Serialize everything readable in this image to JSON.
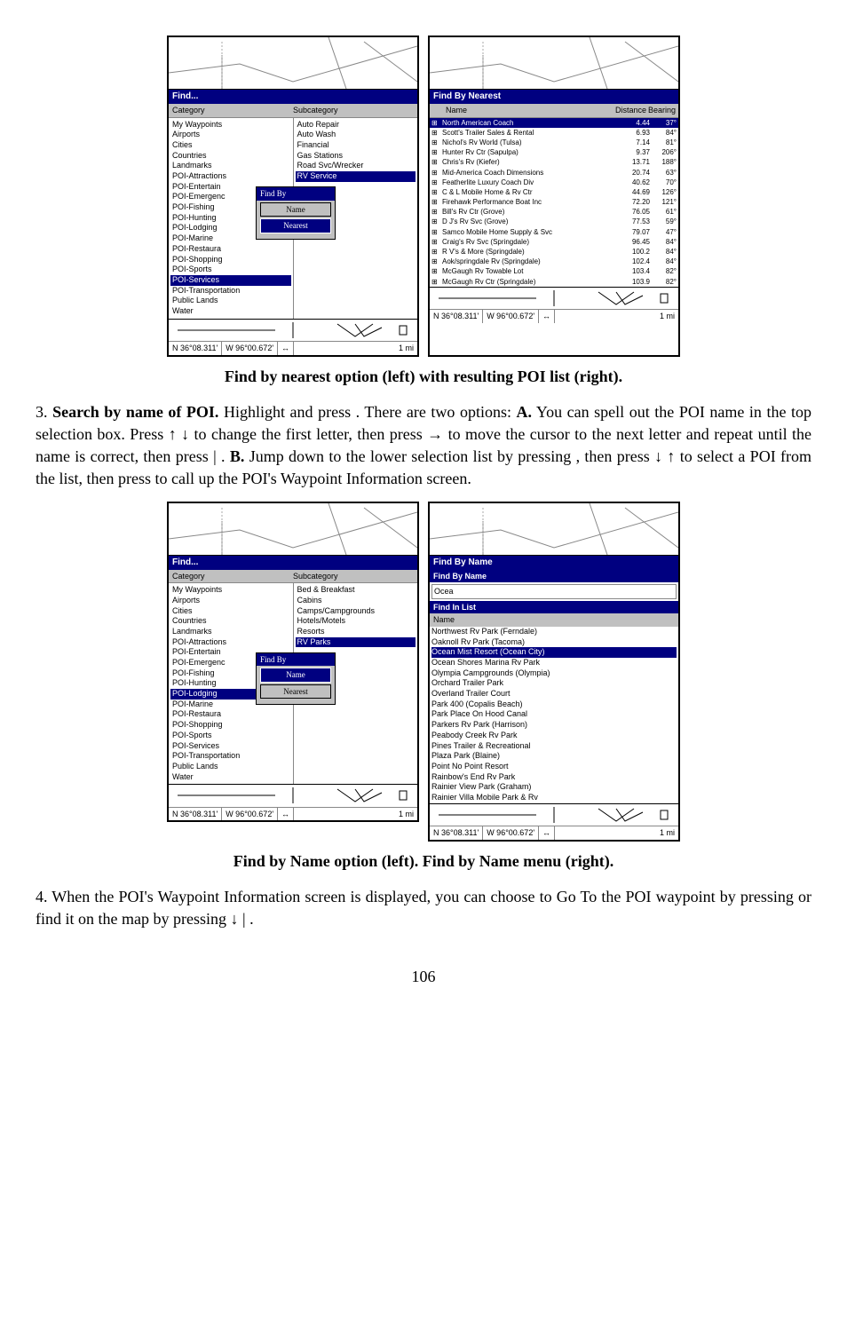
{
  "screen1_left": {
    "title": "Find...",
    "header_cat": "Category",
    "header_sub": "Subcategory",
    "categories": [
      "My Waypoints",
      "Airports",
      "Cities",
      "Countries",
      "Landmarks",
      "POI-Attractions",
      "POI-Entertain",
      "POI-Emergenc",
      "POI-Fishing",
      "POI-Hunting",
      "POI-Lodging",
      "POI-Marine",
      "POI-Restaura",
      "POI-Shopping",
      "POI-Sports",
      "POI-Services",
      "POI-Transportation",
      "Public Lands",
      "Water"
    ],
    "cat_sel_index": 15,
    "subcategories": [
      "Auto Repair",
      "Auto Wash",
      "Financial",
      "Gas Stations",
      "Road Svc/Wrecker",
      "RV Service"
    ],
    "sub_sel_index": 5,
    "popup_title": "Find By",
    "popup_btn1": "Name",
    "popup_btn2": "Nearest",
    "popup_sel": 2,
    "coords_n": "N    36°08.311'",
    "coords_w": "W    96°00.672'",
    "scale": "1 mi"
  },
  "screen1_right": {
    "title": "Find By Nearest",
    "hdr_name": "Name",
    "hdr_dist": "Distance",
    "hdr_bear": "Bearing",
    "rows": [
      {
        "name": "North American Coach",
        "dist": "4.44",
        "bear": "37°",
        "sel": true
      },
      {
        "name": "Scott's Trailer Sales & Rental",
        "dist": "6.93",
        "bear": "84°"
      },
      {
        "name": "Nichol's Rv World (Tulsa)",
        "dist": "7.14",
        "bear": "81°"
      },
      {
        "name": "Hunter Rv Ctr (Sapulpa)",
        "dist": "9.37",
        "bear": "206°"
      },
      {
        "name": "Chris's Rv (Kiefer)",
        "dist": "13.71",
        "bear": "188°"
      },
      {
        "name": "Mid-America Coach Dimensions",
        "dist": "20.74",
        "bear": "63°"
      },
      {
        "name": "Featherlite Luxury Coach Div",
        "dist": "40.62",
        "bear": "70°"
      },
      {
        "name": "C & L Mobile Home & Rv Ctr",
        "dist": "44.69",
        "bear": "126°"
      },
      {
        "name": "Firehawk Performance Boat Inc",
        "dist": "72.20",
        "bear": "121°"
      },
      {
        "name": "Bill's Rv Ctr (Grove)",
        "dist": "76.05",
        "bear": "61°"
      },
      {
        "name": "D J's Rv Svc (Grove)",
        "dist": "77.53",
        "bear": "59°"
      },
      {
        "name": "Samco Mobile Home Supply & Svc",
        "dist": "79.07",
        "bear": "47°"
      },
      {
        "name": "Craig's Rv Svc (Springdale)",
        "dist": "96.45",
        "bear": "84°"
      },
      {
        "name": "R V's & More (Springdale)",
        "dist": "100.2",
        "bear": "84°"
      },
      {
        "name": "Aok/springdale Rv (Springdale)",
        "dist": "102.4",
        "bear": "84°"
      },
      {
        "name": "McGaugh Rv Towable Lot",
        "dist": "103.4",
        "bear": "82°"
      },
      {
        "name": "McGaugh Rv Ctr (Springdale)",
        "dist": "103.9",
        "bear": "82°"
      }
    ],
    "coords_n": "N    36°08.311'",
    "coords_w": "W    96°00.672'",
    "scale": "1 mi"
  },
  "caption1": "Find by nearest option (left) with resulting POI list (right).",
  "paragraph1_a": "3. ",
  "paragraph1_b": "Search by name of POI.",
  "paragraph1_c": " Highlight           and press       . There are two options: ",
  "paragraph1_d": "A.",
  "paragraph1_e": " You can spell out the POI name in the top selection box. Press ↑ ↓ to change the first letter, then press → to move the cursor to the next letter and repeat until the name is correct, then press       |      . ",
  "paragraph1_f": "B.",
  "paragraph1_g": " Jump down to the lower selection list by pressing        , then press ↓ ↑ to select a POI from the list, then press          to call up the POI's Waypoint Information screen.",
  "screen2_left": {
    "title": "Find...",
    "header_cat": "Category",
    "header_sub": "Subcategory",
    "categories": [
      "My Waypoints",
      "Airports",
      "Cities",
      "Countries",
      "Landmarks",
      "POI-Attractions",
      "POI-Entertain",
      "POI-Emergenc",
      "POI-Fishing",
      "POI-Hunting",
      "POI-Lodging",
      "POI-Marine",
      "POI-Restaura",
      "POI-Shopping",
      "POI-Sports",
      "POI-Services",
      "POI-Transportation",
      "Public Lands",
      "Water"
    ],
    "cat_sel_index": 10,
    "subcategories": [
      "Bed & Breakfast",
      "Cabins",
      "Camps/Campgrounds",
      "Hotels/Motels",
      "Resorts",
      "RV Parks"
    ],
    "sub_sel_index": 5,
    "popup_title": "Find By",
    "popup_btn1": "Name",
    "popup_btn2": "Nearest",
    "popup_sel": 1,
    "coords_n": "N    36°08.311'",
    "coords_w": "W    96°00.672'",
    "scale": "1 mi"
  },
  "screen2_right": {
    "title": "Find By Name",
    "section1": "Find By Name",
    "input_val": "Ocea",
    "section2": "Find In List",
    "list_hdr": "Name",
    "items": [
      "Northwest Rv Park (Ferndale)",
      "Oaknoll Rv Park (Tacoma)",
      "Ocean Mist Resort (Ocean City)",
      "Ocean Shores Marina Rv Park",
      "Olympia Campgrounds (Olympia)",
      "Orchard Trailer Park",
      "Overland Trailer Court",
      "Park 400 (Copalis Beach)",
      "Park Place On Hood Canal",
      "Parkers Rv Park (Harrison)",
      "Peabody Creek Rv Park",
      "Pines Trailer & Recreational",
      "Plaza Park (Blaine)",
      "Point No Point Resort",
      "Rainbow's End Rv Park",
      "Rainier View Park (Graham)",
      "Rainier Villa Mobile Park & Rv"
    ],
    "sel_index": 2,
    "coords_n": "N    36°08.311'",
    "coords_w": "W    96°00.672'",
    "scale": "1 mi"
  },
  "caption2": "Find by Name option (left). Find by Name menu (right).",
  "paragraph2": "4. When the POI's Waypoint Information screen is displayed, you can choose to Go To the POI waypoint by pressing         or find it on the map by pressing ↓ |        .",
  "pagenum": "106"
}
